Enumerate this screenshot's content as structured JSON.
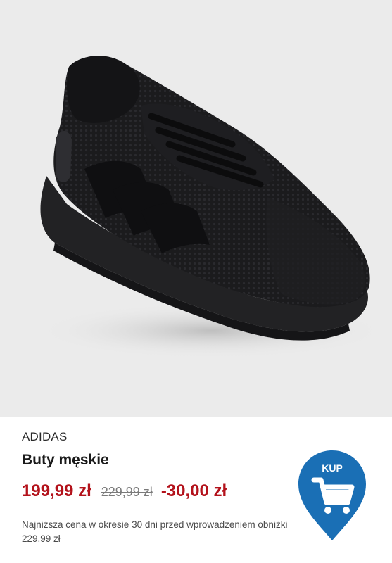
{
  "product": {
    "image_alt": "Czarne buty sportowe ADIDAS",
    "brand": "ADIDAS",
    "title": "Buty męskie",
    "price_current": "199,99 zł",
    "price_old": "229,99 zł",
    "price_discount": "-30,00 zł",
    "lowest_price_note": "Najniższa cena w okresie 30 dni przed wprowadzeniem obniżki 229,99 zł"
  },
  "buy_button": {
    "label": "KUP",
    "icon": "shopping-cart-icon",
    "color": "#1a6fb5"
  },
  "colors": {
    "price_accent": "#b3121b",
    "image_background": "#ebebeb"
  }
}
